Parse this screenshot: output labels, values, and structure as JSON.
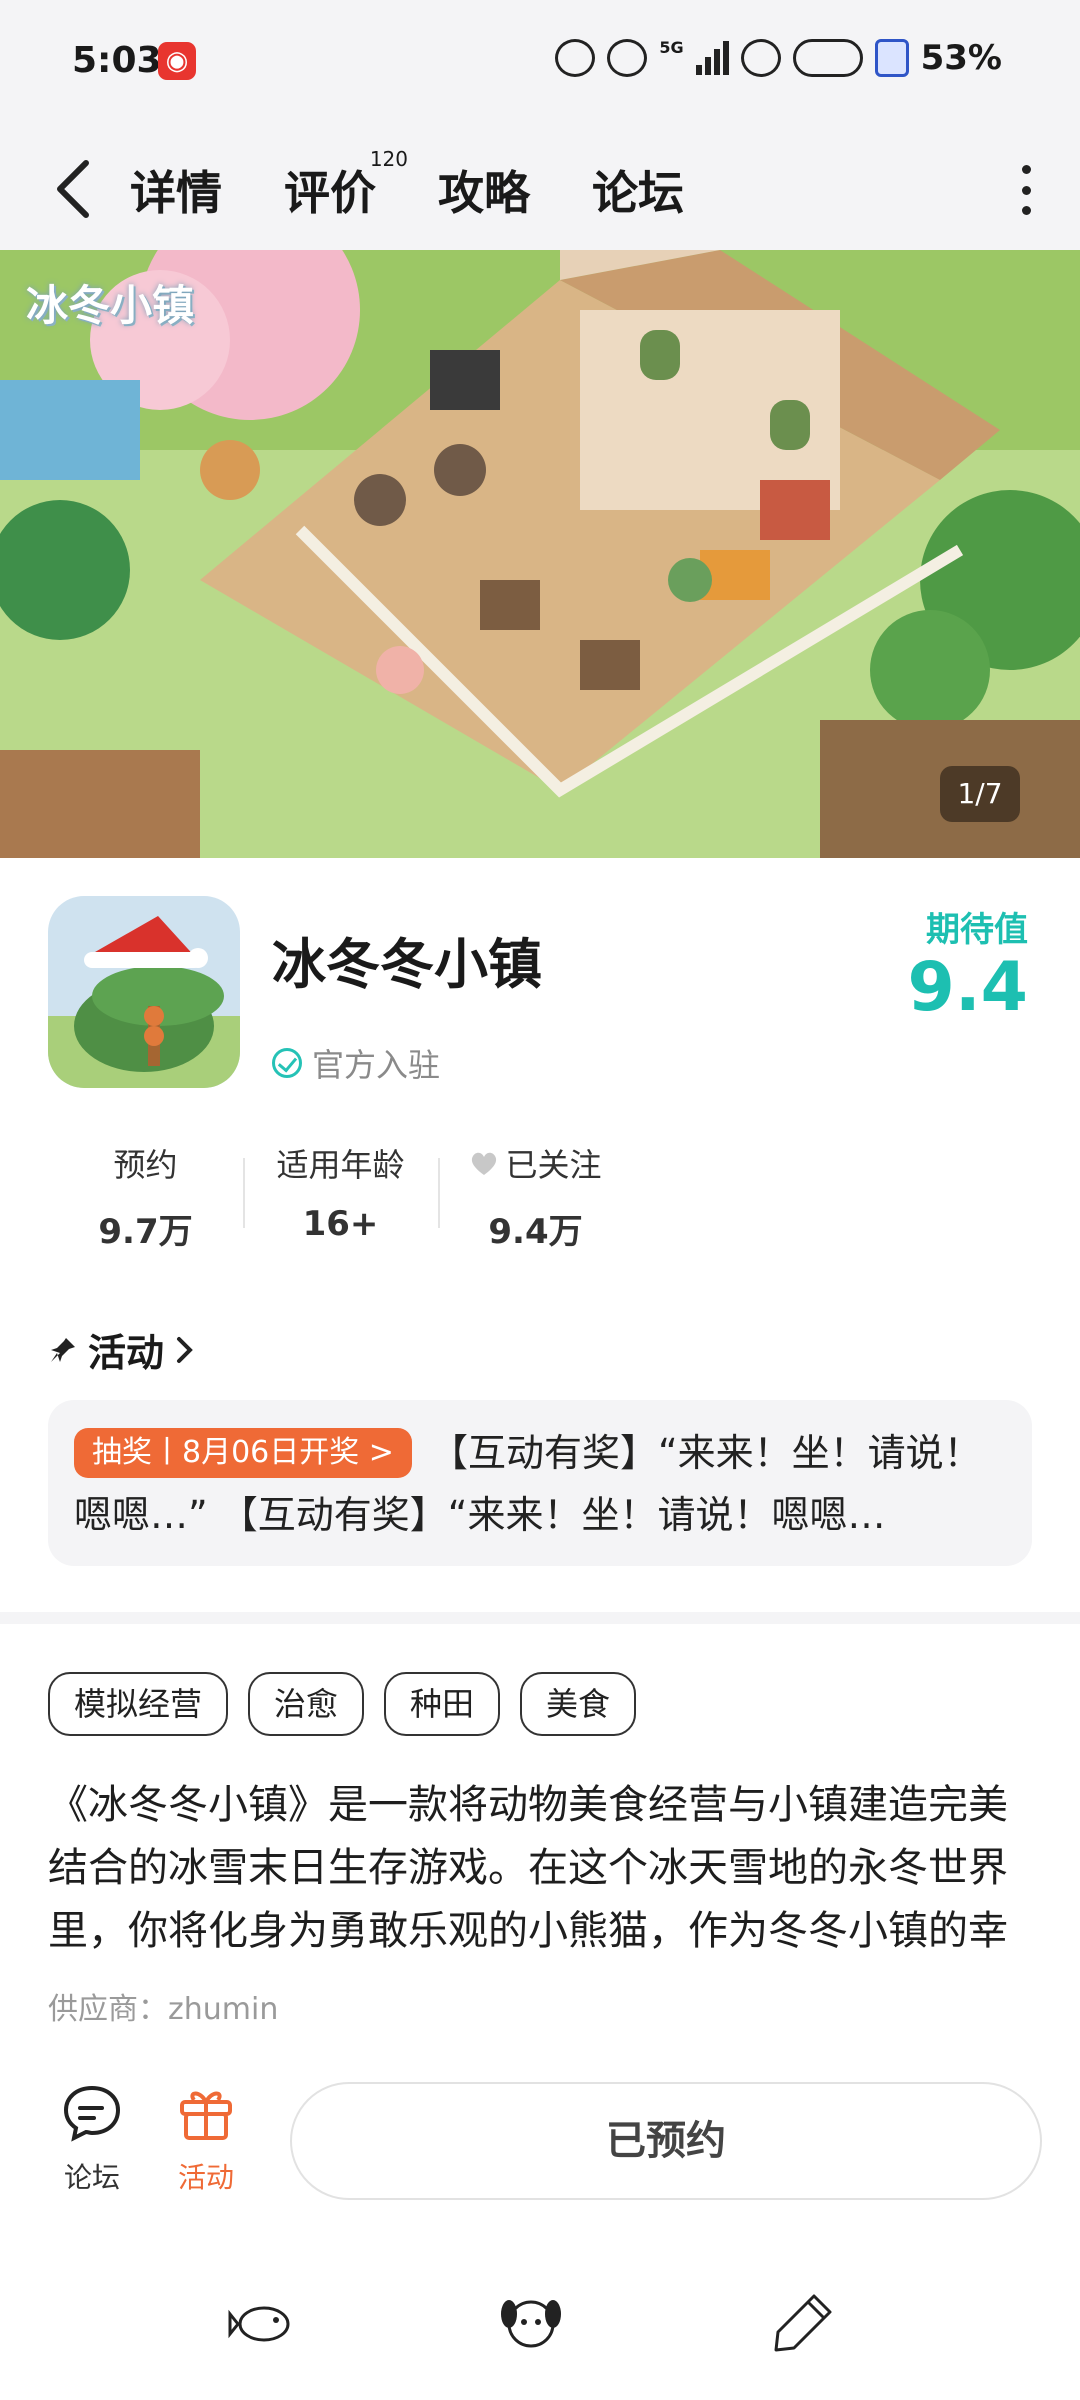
{
  "status_bar": {
    "time": "5:03",
    "network": "5G",
    "battery": "53%"
  },
  "nav": {
    "tabs": [
      {
        "label": "详情",
        "active": true
      },
      {
        "label": "评价",
        "count": "120"
      },
      {
        "label": "攻略"
      },
      {
        "label": "论坛"
      }
    ]
  },
  "hero": {
    "logo_text": "冰冬小镇",
    "counter": "1/7"
  },
  "app": {
    "name": "冰冬冬小镇",
    "official_label": "官方入驻",
    "expect_label": "期待值",
    "expect_score": "9.4"
  },
  "stats": [
    {
      "label": "预约",
      "value": "9.7万"
    },
    {
      "label": "适用年龄",
      "value": "16+"
    },
    {
      "label": "已关注",
      "value": "9.4万"
    }
  ],
  "activity": {
    "title": "活动",
    "badge": "抽奖丨8月06日开奖 >",
    "text": "【互动有奖】“来来！坐！请说！嗯嗯…” 【互动有奖】“来来！坐！请说！嗯嗯…"
  },
  "tags": [
    "模拟经营",
    "治愈",
    "种田",
    "美食"
  ],
  "description": "《冰冬冬小镇》是一款将动物美食经营与小镇建造完美结合的冰雪末日生存游戏。在这个冰天雪地的永冬世界里，你将化身为勇敢乐观的小熊猫，作为冬冬小镇的幸存者…",
  "supplier": "供应商：zhumin",
  "bottom_bar": {
    "forum": "论坛",
    "activity": "活动",
    "reserve_button": "已预约"
  },
  "colors": {
    "accent": "#25d0c4",
    "score": "#1dbfb1",
    "orange": "#ef6a36"
  }
}
